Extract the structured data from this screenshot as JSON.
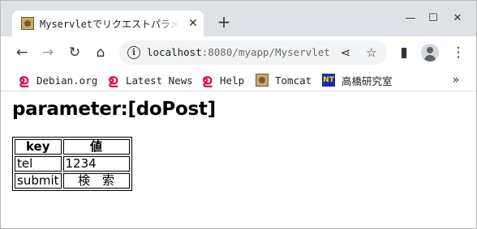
{
  "tab": {
    "title": "Myservletでリクエストパラメ",
    "close_glyph": "✕"
  },
  "newtab_glyph": "+",
  "window_controls": {
    "minimize": "—",
    "maximize": "☐",
    "close": "✕"
  },
  "toolbar": {
    "back": "←",
    "forward": "→",
    "reload": "↻",
    "home": "⌂",
    "url_host": "localhost",
    "url_rest": ":8080/myapp/Myservlet",
    "share": "⋖",
    "star": "☆",
    "sidepanel": "▮",
    "menu": "⋮"
  },
  "bookmarks": {
    "items": [
      {
        "label": "Debian.org",
        "icon": "debian-swirl-icon"
      },
      {
        "label": "Latest News",
        "icon": "debian-swirl-icon"
      },
      {
        "label": "Help",
        "icon": "debian-swirl-icon"
      },
      {
        "label": "Tomcat",
        "icon": "tomcat-icon"
      },
      {
        "label": "高橋研究室",
        "icon": "nt-icon"
      }
    ],
    "more": "»"
  },
  "page": {
    "heading": "parameter:[doPost]",
    "table": {
      "headers": [
        "key",
        "値"
      ],
      "rows": [
        [
          "tel",
          "1234"
        ],
        [
          "submit",
          "検　索"
        ]
      ]
    }
  }
}
